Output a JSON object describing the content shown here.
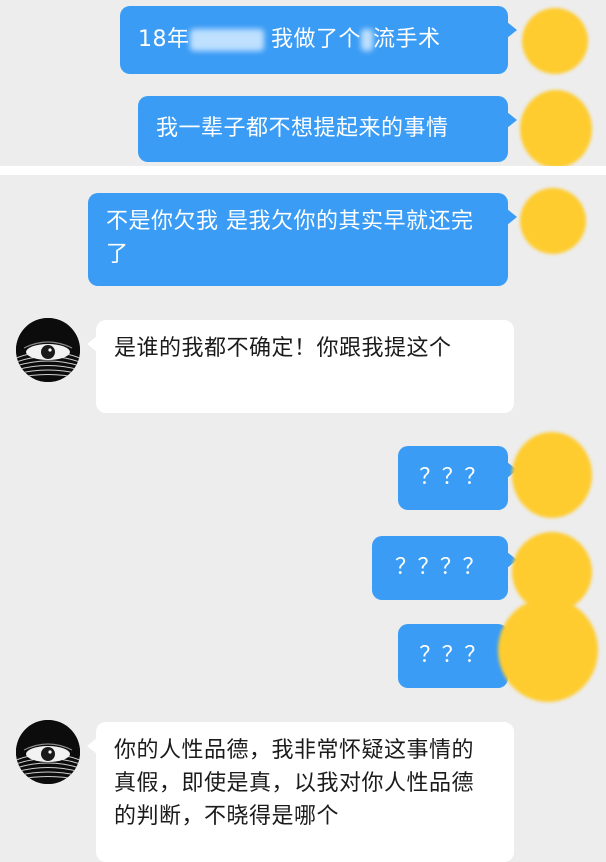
{
  "messages": [
    {
      "id": 1,
      "sender": "me",
      "text_parts": [
        "18年",
        "我做了个",
        "流手术"
      ]
    },
    {
      "id": 2,
      "sender": "me",
      "text": "我一辈子都不想提起来的事情"
    },
    {
      "id": 3,
      "sender": "me",
      "text": "不是你欠我 是我欠你的其实早就还完了"
    },
    {
      "id": 4,
      "sender": "them",
      "text": "是谁的我都不确定！你跟我提这个"
    },
    {
      "id": 5,
      "sender": "me",
      "text": "？？？"
    },
    {
      "id": 6,
      "sender": "me",
      "text": "？？？？"
    },
    {
      "id": 7,
      "sender": "me",
      "text": "？？？"
    },
    {
      "id": 8,
      "sender": "them",
      "text": "你的人性品德，我非常怀疑这事情的真假，即使是真，以我对你人性品德的判断，不晓得是哪个"
    }
  ],
  "avatars": {
    "me": {
      "color": "#fecc2f",
      "icon": "avatar-yellow-circle"
    },
    "them": {
      "icon": "eye-avatar-icon"
    }
  },
  "colors": {
    "background": "#ededed",
    "me_bubble": "#3a9cf5",
    "them_bubble": "#ffffff"
  }
}
